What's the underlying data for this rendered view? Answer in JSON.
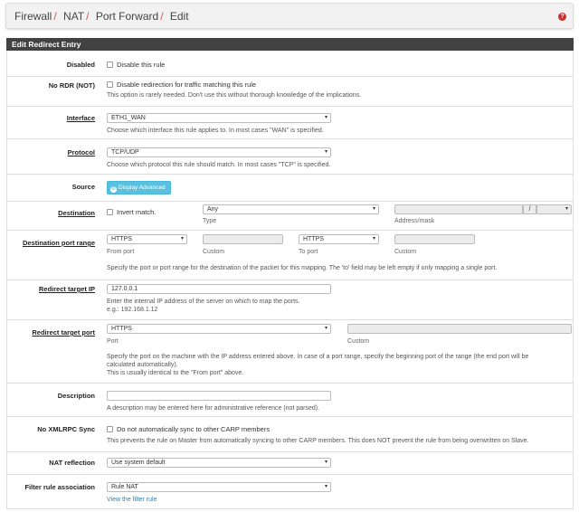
{
  "breadcrumb": [
    "Firewall",
    "NAT",
    "Port Forward",
    "Edit"
  ],
  "panel_title": "Edit Redirect Entry",
  "rows": {
    "disabled": {
      "label": "Disabled",
      "checkbox": "Disable this rule"
    },
    "nordr": {
      "label": "No RDR (NOT)",
      "checkbox": "Disable redirection for traffic matching this rule",
      "help": "This option is rarely needed. Don't use this without thorough knowledge of the implications."
    },
    "interface": {
      "label": "Interface",
      "value": "ETH1_WAN",
      "help": "Choose which interface this rule applies to. In most cases \"WAN\" is specified."
    },
    "protocol": {
      "label": "Protocol",
      "value": "TCP/UDP",
      "help": "Choose which protocol this rule should match. In most cases \"TCP\" is specified."
    },
    "source": {
      "label": "Source",
      "button": "Display Advanced"
    },
    "destination": {
      "label": "Destination",
      "checkbox": "Invert match.",
      "type_value": "Any",
      "type_caption": "Type",
      "address_caption": "Address/mask",
      "slash": "/"
    },
    "dest_port": {
      "label": "Destination port range",
      "from_value": "HTTPS",
      "from_caption": "From port",
      "custom_caption": "Custom",
      "to_value": "HTTPS",
      "to_caption": "To port",
      "custom2_caption": "Custom",
      "help": "Specify the port or port range for the destination of the packet for this mapping. The 'to' field may be left empty if only mapping a single port."
    },
    "redirect_ip": {
      "label": "Redirect target IP",
      "value": "127.0.0.1",
      "help1": "Enter the internal IP address of the server on which to map the ports.",
      "help2": "e.g.: 192.168.1.12"
    },
    "redirect_port": {
      "label": "Redirect target port",
      "value": "HTTPS",
      "port_caption": "Port",
      "custom_caption": "Custom",
      "help1": "Specify the port on the machine with the IP address entered above. In case of a port range, specify the beginning port of the range (the end port will be",
      "help2": "calculated automatically).",
      "help3": "This is usually identical to the \"From port\" above."
    },
    "description": {
      "label": "Description",
      "value": "",
      "help": "A description may be entered here for administrative reference (not parsed)."
    },
    "noxmlrpc": {
      "label": "No XMLRPC Sync",
      "checkbox": "Do not automatically sync to other CARP members",
      "help": "This prevents the rule on Master from automatically syncing to other CARP members. This does NOT prevent the rule from being overwritten on Slave."
    },
    "nat_reflection": {
      "label": "NAT reflection",
      "value": "Use system default"
    },
    "filter_assoc": {
      "label": "Filter rule association",
      "value": "Rule NAT",
      "link": "View the filter rule"
    }
  },
  "icons": {
    "help": "?",
    "dropdown": "▾",
    "gear": "⚙"
  },
  "colors": {
    "accent_red": "#d9534f",
    "heading_bg": "#424242",
    "info_btn": "#5bc0de",
    "link": "#317eac"
  }
}
